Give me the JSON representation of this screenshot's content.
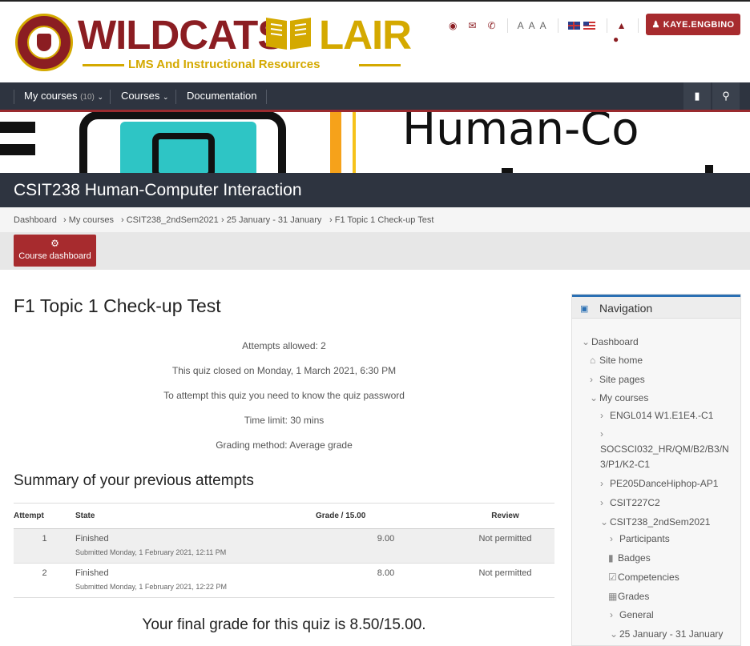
{
  "brand": {
    "title": "WILDCATS",
    "title2": "LAIR",
    "subtitle": "LMS And Instructional Resources",
    "seal_text": "CEBU INSTITUTE OF TECHNOLOGY UNIVERSITY"
  },
  "top_icons": {
    "font_size_label": "A A A",
    "user_button": "KAYE.ENGBINO"
  },
  "nav": {
    "my_courses": "My courses",
    "my_courses_count": "(10)",
    "courses": "Courses",
    "documentation": "Documentation"
  },
  "banner_text": "Human-Co",
  "course_title": "CSIT238 Human-Computer Interaction",
  "breadcrumb": [
    "Dashboard",
    "My courses",
    "CSIT238_2ndSem2021",
    "25 January - 31 January",
    "F1 Topic 1 Check-up Test"
  ],
  "course_dashboard_btn": "Course dashboard",
  "quiz": {
    "title": "F1 Topic 1 Check-up Test",
    "info": [
      "Attempts allowed: 2",
      "This quiz closed on Monday, 1 March 2021, 6:30 PM",
      "To attempt this quiz you need to know the quiz password",
      "Time limit: 30 mins",
      "Grading method: Average grade"
    ],
    "summary_title": "Summary of your previous attempts",
    "table": {
      "headers": [
        "Attempt",
        "State",
        "Grade / 15.00",
        "Review"
      ],
      "rows": [
        {
          "attempt": "1",
          "state": "Finished",
          "submitted": "Submitted Monday, 1 February 2021, 12:11 PM",
          "grade": "9.00",
          "review": "Not permitted"
        },
        {
          "attempt": "2",
          "state": "Finished",
          "submitted": "Submitted Monday, 1 February 2021, 12:22 PM",
          "grade": "8.00",
          "review": "Not permitted"
        }
      ]
    },
    "final_grade": "Your final grade for this quiz is 8.50/15.00."
  },
  "navigation": {
    "title": "Navigation",
    "items": [
      "Dashboard",
      "Site home",
      "Site pages",
      "My courses",
      "ENGL014 W1.E1E4.-C1",
      "SOCSCI032_HR/QM/B2/B3/N",
      "3/P1/K2-C1",
      "PE205DanceHiphop-AP1",
      "CSIT227C2",
      "CSIT238_2ndSem2021",
      "Participants",
      "Badges",
      "Competencies",
      "Grades",
      "General",
      "25 January - 31 January"
    ]
  },
  "colors": {
    "brand_red": "#8b1d22",
    "brand_gold": "#d4a900",
    "button_red": "#a72b2e",
    "navbar": "#2e3440",
    "nav_accent": "#2a6fb3"
  }
}
